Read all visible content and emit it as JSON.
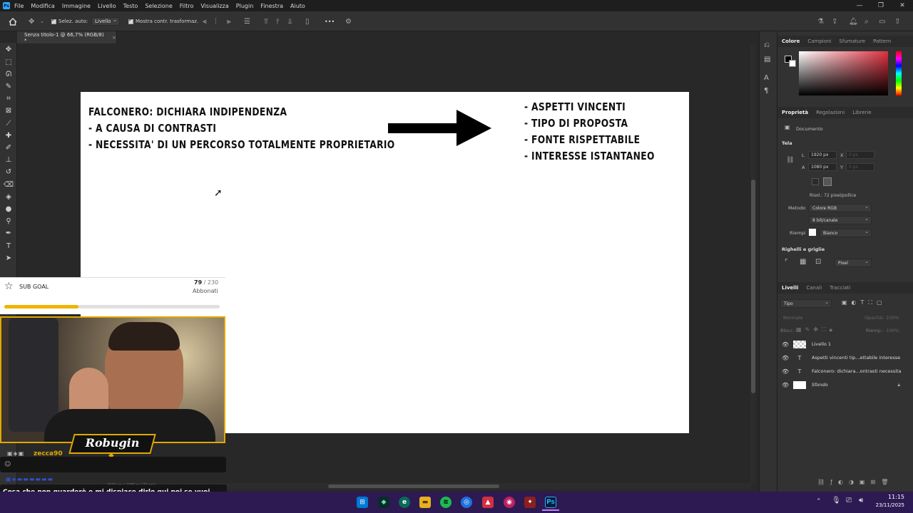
{
  "app": {
    "menu": [
      "File",
      "Modifica",
      "Immagine",
      "Livello",
      "Testo",
      "Selezione",
      "Filtro",
      "Visualizza",
      "Plugin",
      "Finestra",
      "Aiuto"
    ],
    "window_controls": [
      "—",
      "❐",
      "✕"
    ]
  },
  "options_bar": {
    "auto_select_label": "Selez. auto:",
    "auto_select_value": "Livello",
    "show_transform_label": "Mostra contr. trasformaz.",
    "more": "•••"
  },
  "document_tab": {
    "title": "Senza titolo-1 @ 66,7% (RGB/8) *",
    "close": "×"
  },
  "slide": {
    "left_lines": [
      "FALCONERO: DICHIARA INDIPENDENZA",
      "-  A CAUSA DI CONTRASTI",
      "-  NECESSITA' DI UN PERCORSO TOTALMENTE PROPRIETARIO"
    ],
    "right_lines": [
      "-  ASPETTI VINCENTI",
      "-  TIPO DI PROPOSTA",
      "-  FONTE RISPETTABILE",
      "-  INTERESSE ISTANTANEO"
    ]
  },
  "color_panel": {
    "tabs": [
      "Colore",
      "Campioni",
      "Sfumature",
      "Pattern"
    ],
    "active_tab": "Colore",
    "accent": "#e03040"
  },
  "properties_panel": {
    "tabs": [
      "Proprietà",
      "Regolazioni",
      "Librerie"
    ],
    "active_tab": "Proprietà",
    "doc_label": "Documento",
    "section_canvas": "Tela",
    "L_label": "L",
    "L_value": "1920 px",
    "A_label": "A",
    "A_value": "1080 px",
    "X_label": "X",
    "X_placeholder": "0 px",
    "Y_label": "Y",
    "Y_placeholder": "0 px",
    "resolution": "Risol.: 72 pixel/pollice",
    "mode_label": "Metodo",
    "mode_value": "Colore RGB",
    "depth_value": "8 bit/canale",
    "fill_label": "Riempi",
    "fill_value": "Bianco",
    "section_rulers": "Righelli e griglie",
    "unit_value": "Pixel"
  },
  "layers_panel": {
    "tabs": [
      "Livelli",
      "Canali",
      "Tracciati"
    ],
    "active_tab": "Livelli",
    "filter_value": "Tipo",
    "blend_value": "Normale",
    "opacity_label": "Opacità:",
    "opacity_value": "100%",
    "lock_label": "Blocc.:",
    "fill_label": "Riemp.:",
    "fill_value": "100%",
    "layers": [
      {
        "name": "Livello 1",
        "kind": "pixel"
      },
      {
        "name": "Aspetti vincenti tip...ettabile interesse",
        "kind": "text"
      },
      {
        "name": "Falconero: dichiara...ontrasti necessita",
        "kind": "text"
      },
      {
        "name": "Sfondo",
        "kind": "background"
      }
    ]
  },
  "overlay": {
    "sub_goal_label": "SUB GOAL",
    "sub_goal_current": "79",
    "sub_goal_sep": " / ",
    "sub_goal_target": "230",
    "sub_goal_unit": "Abbonati",
    "sub_goal_progress": 0.343,
    "streamer_name": "Robugin",
    "chat_user": "zecca90",
    "chat_message": "Cosa che non guarderò e mi dispiace dirlo qui poi se vuoi puoi bannarmi qui tanto ho già un altro account",
    "status_hint": "1920 px x 1080 px (72 ppi)"
  },
  "taskbar": {
    "time": "11:15",
    "date": "23/11/2025",
    "ps_label": "Ps"
  }
}
